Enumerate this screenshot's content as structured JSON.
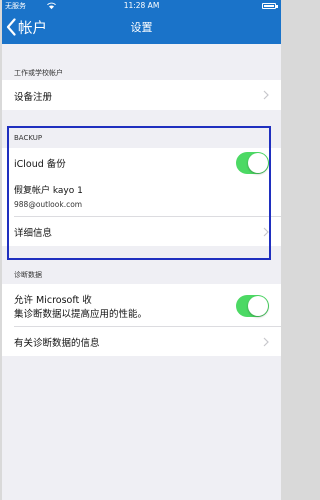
{
  "status_bar": {
    "carrier": "无服务",
    "time": "11:28 AM"
  },
  "nav": {
    "back_label": "帐户",
    "title": "设置"
  },
  "work_section": {
    "header": "工作或学校帐户",
    "items": [
      {
        "label": "设备注册"
      }
    ]
  },
  "backup_section": {
    "header": "BACKUP",
    "icloud_label": "iCloud 备份",
    "icloud_enabled": true,
    "account_name": "假复帐户 kayo 1",
    "account_email": "988@outlook.com",
    "details_label": "详细信息"
  },
  "diagnostics_section": {
    "header": "诊断数据",
    "allow_label_line1": "允许 Microsoft 收",
    "allow_label_line2": "集诊断数据以提高应用的性能。",
    "allow_enabled": true,
    "info_label": "有关诊断数据的信息"
  },
  "colors": {
    "nav_bar": "#1a73c9",
    "toggle_on": "#4cd964",
    "highlight_border": "#1f2fbf"
  }
}
